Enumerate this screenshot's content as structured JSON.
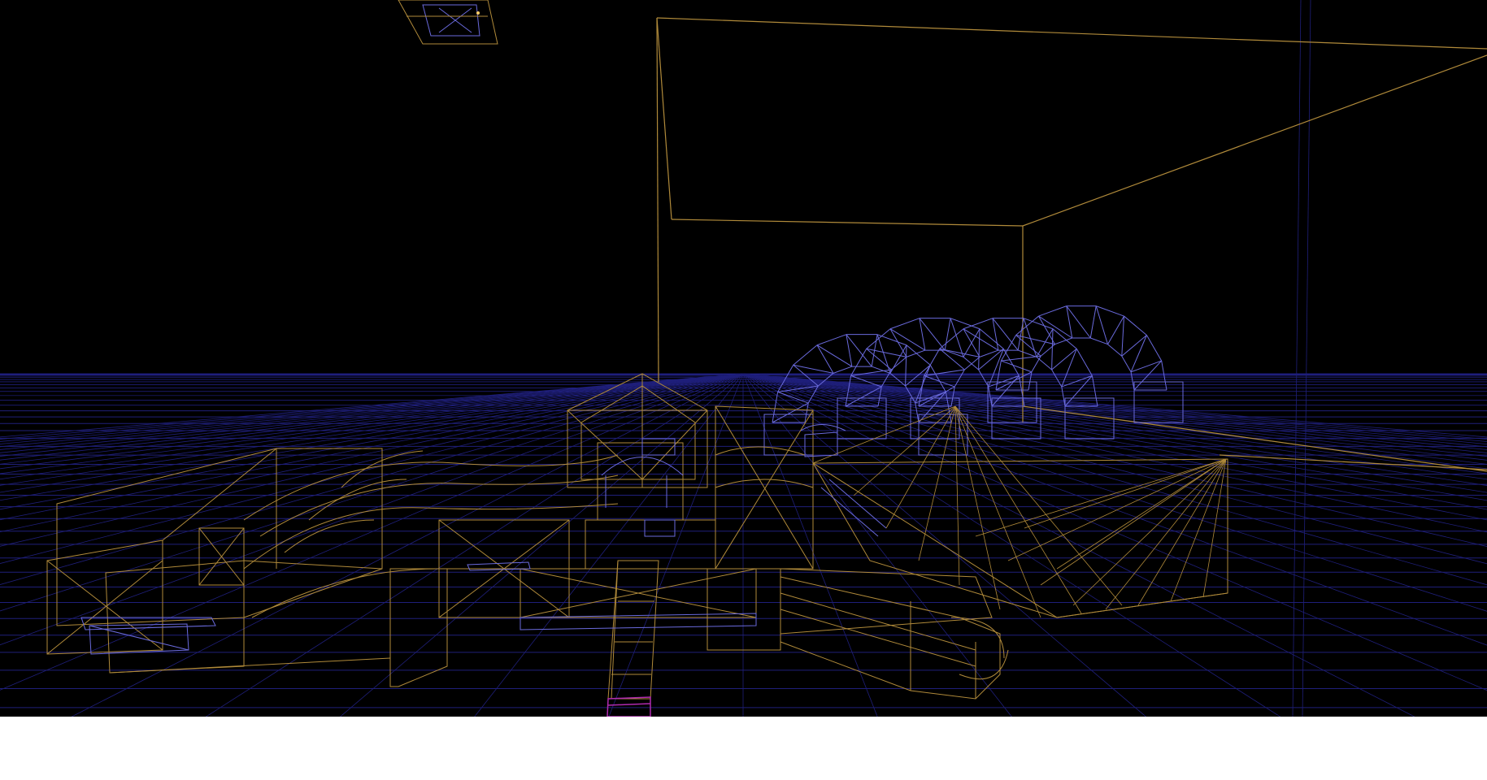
{
  "view": {
    "mode": "wireframe",
    "colors": {
      "background": "#000000",
      "floor_grid": "#1f1f7a",
      "floor_grid_far": "#2a2aa8",
      "world_brush": "#b08a3a",
      "detail_brush": "#6a6adc",
      "selected_brush": "#b02ab0",
      "below_viewport": "#ffffff"
    }
  }
}
